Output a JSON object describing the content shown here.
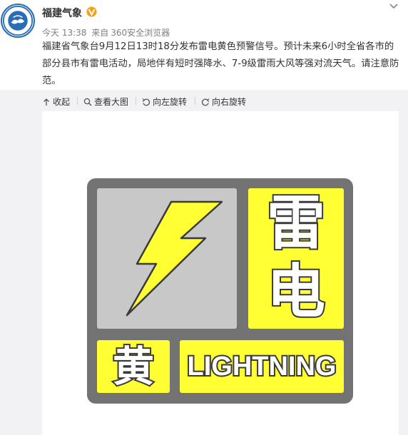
{
  "post": {
    "author": "福建气象",
    "time": "今天 13:38",
    "source_prefix": "来自",
    "source": "360安全浏览器",
    "text": "福建省气象台9月12日13时18分发布雷电黄色预警信号。预计未来6小时全省各市的部分县市有雷电活动，局地伴有短时强降水、7-9级雷雨大风等强对流天气。请注意防范。"
  },
  "toolbar": {
    "collapse": "收起",
    "view_large": "查看大图",
    "rotate_left": "向左旋转",
    "rotate_right": "向右旋转"
  },
  "sign": {
    "char_top": "雷",
    "char_mid": "电",
    "char_level": "黄",
    "english": "LIGHTNING"
  },
  "colors": {
    "sign_yellow": "#ffff33",
    "sign_gray_border": "#737373",
    "sign_gray_panel": "#c8c8c8",
    "verified_orange": "#f4a01a",
    "toolbar_bg": "#f2f2f5"
  },
  "icons": {
    "avatar": "meteorological-bureau-logo",
    "verified": "verified-badge-icon",
    "menu": "chevron-down-icon",
    "collapse": "arrow-up-icon",
    "view_large": "magnifier-icon",
    "rotate_left": "rotate-left-icon",
    "rotate_right": "rotate-right-icon",
    "lightning": "lightning-bolt-icon"
  }
}
